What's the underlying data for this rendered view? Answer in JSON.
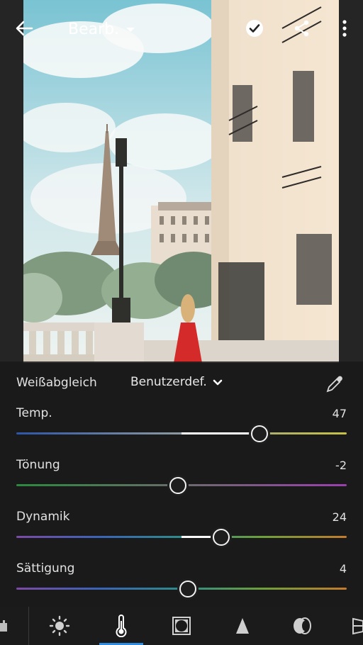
{
  "header": {
    "title": "Bearb.",
    "back_icon": "back-arrow-icon",
    "apply_icon": "checkmark-circle-icon",
    "share_icon": "share-icon",
    "more_icon": "more-vertical-icon"
  },
  "white_balance": {
    "label": "Weißabgleich",
    "preset": "Benutzerdef.",
    "eyedropper_icon": "eyedropper-icon"
  },
  "sliders": [
    {
      "label": "Temp.",
      "value": "47",
      "level": 0.735
    },
    {
      "label": "Tönung",
      "value": "-2",
      "level": 0.49
    },
    {
      "label": "Dynamik",
      "value": "24",
      "level": 0.62
    },
    {
      "label": "Sättigung",
      "value": "4",
      "level": 0.52
    }
  ],
  "toolbar": {
    "tools": [
      "crop-icon",
      "light-icon",
      "color-thermometer-icon",
      "vignette-icon",
      "detail-icon",
      "optics-icon",
      "geometry-icon"
    ],
    "active": "color-thermometer-icon"
  },
  "colors": {
    "accent": "#2f8be0",
    "panel": "#1e1e1e"
  }
}
